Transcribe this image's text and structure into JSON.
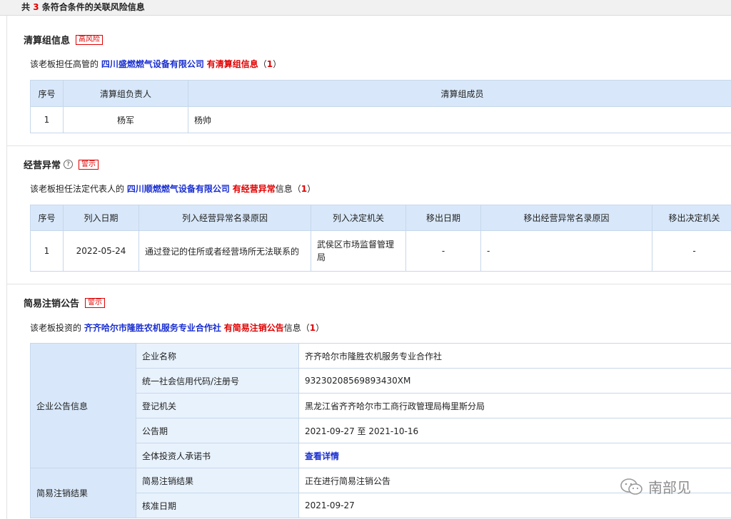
{
  "header": {
    "prefix": "共",
    "count": "3",
    "suffix": "条符合条件的关联风险信息"
  },
  "liquidation": {
    "title": "清算组信息",
    "badge": "高风险",
    "desc": {
      "pre": "该老板担任高管的",
      "company": "四川盛燃燃气设备有限公司",
      "has": "有清算组信息",
      "open": "（",
      "count": "1",
      "close": "）"
    },
    "headers": [
      "序号",
      "清算组负责人",
      "清算组成员"
    ],
    "rows": [
      [
        "1",
        "杨军",
        "杨帅"
      ]
    ]
  },
  "abnormal": {
    "title": "经营异常",
    "badge": "警示",
    "desc": {
      "pre": "该老板担任法定代表人的",
      "company": "四川顺燃燃气设备有限公司",
      "has": "有经营异常",
      "tail": "信息",
      "open": "（",
      "count": "1",
      "close": "）"
    },
    "headers": [
      "序号",
      "列入日期",
      "列入经营异常名录原因",
      "列入决定机关",
      "移出日期",
      "移出经营异常名录原因",
      "移出决定机关"
    ],
    "rows": [
      [
        "1",
        "2022-05-24",
        "通过登记的住所或者经营场所无法联系的",
        "武侯区市场监督管理局",
        "-",
        "-",
        "-"
      ]
    ]
  },
  "simple_cancel": {
    "title": "简易注销公告",
    "badge": "警示",
    "desc": {
      "pre": "该老板投资的",
      "company": "齐齐哈尔市隆胜农机服务专业合作社",
      "has": "有简易注销公告",
      "tail": "信息",
      "open": "（",
      "count": "1",
      "close": "）"
    },
    "group1": "企业公告信息",
    "group2": "简易注销结果",
    "rows": [
      {
        "label": "企业名称",
        "value": "齐齐哈尔市隆胜农机服务专业合作社"
      },
      {
        "label": "统一社会信用代码/注册号",
        "value": "93230208569893430XM"
      },
      {
        "label": "登记机关",
        "value": "黑龙江省齐齐哈尔市工商行政管理局梅里斯分局"
      },
      {
        "label": "公告期",
        "value": "2021-09-27 至 2021-10-16"
      },
      {
        "label": "全体投资人承诺书",
        "value": "查看详情"
      },
      {
        "label": "简易注销结果",
        "value": "正在进行简易注销公告"
      },
      {
        "label": "核准日期",
        "value": "2021-09-27"
      }
    ]
  },
  "watermark": {
    "text": "南部见",
    "icon": "wechat-icon"
  }
}
